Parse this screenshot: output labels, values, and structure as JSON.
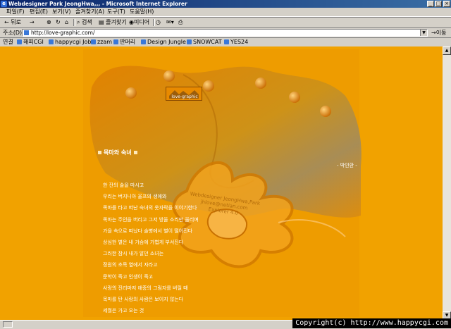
{
  "window": {
    "title": "Webdesigner Park JeongHwa,,, - Microsoft Internet Explorer",
    "buttons": {
      "minimize": "_",
      "maximize": "□",
      "close": "×"
    }
  },
  "menu": [
    "파일(F)",
    "편집(E)",
    "보기(V)",
    "즐겨찾기(A)",
    "도구(T)",
    "도움말(H)"
  ],
  "toolbar": {
    "back": "← 뒤로",
    "forward": "→",
    "search": "검색",
    "favorites": "즐겨찾기",
    "media": "미디어"
  },
  "address": {
    "label": "주소(D)",
    "url": "http://love-graphic.com/",
    "go": "이동"
  },
  "links": {
    "label": "연결",
    "items": [
      "해피CGI",
      "happycgi Job",
      "zzam",
      "딴머리",
      "Design Jungle",
      "SNOWCAT",
      "YES24"
    ]
  },
  "page": {
    "logo_text": "love-graphic",
    "section_title": "목마와 숙녀",
    "author": "- 박인환 -",
    "watermark": [
      "Webdesigner JeongHwa,Park",
      "jhlove@netian.com",
      "Explorer 4.0"
    ],
    "poem": [
      "한 잔의 술을 마시고",
      "우리는 버지니아 울프의 생애와",
      "목마를 타고 떠난 숙녀의 옷자락을 이야기한다",
      "목마는 주인을 버리고 그저 방울 소리만 울리며",
      "가을 속으로 떠났다 술병에서 별이 떨어진다",
      "상심한 별은 내 가슴에 가볍게 부서진다",
      "그러한 잠시 내가 알던 소녀는",
      "정원의 초목 옆에서 자라고",
      "문학이 죽고 인생이 죽고",
      "사랑의 진리마저 애증의 그림자를 버릴 때",
      "목마를 탄 사랑의 사람은 보이지 않는다",
      "세월은 가고 오는 것"
    ]
  },
  "overlay": {
    "copyright": "Copyright(c) http://www.happycgi.com"
  },
  "colors": {
    "page_bg": "#f1a200",
    "titlebar": "#0a246a"
  }
}
